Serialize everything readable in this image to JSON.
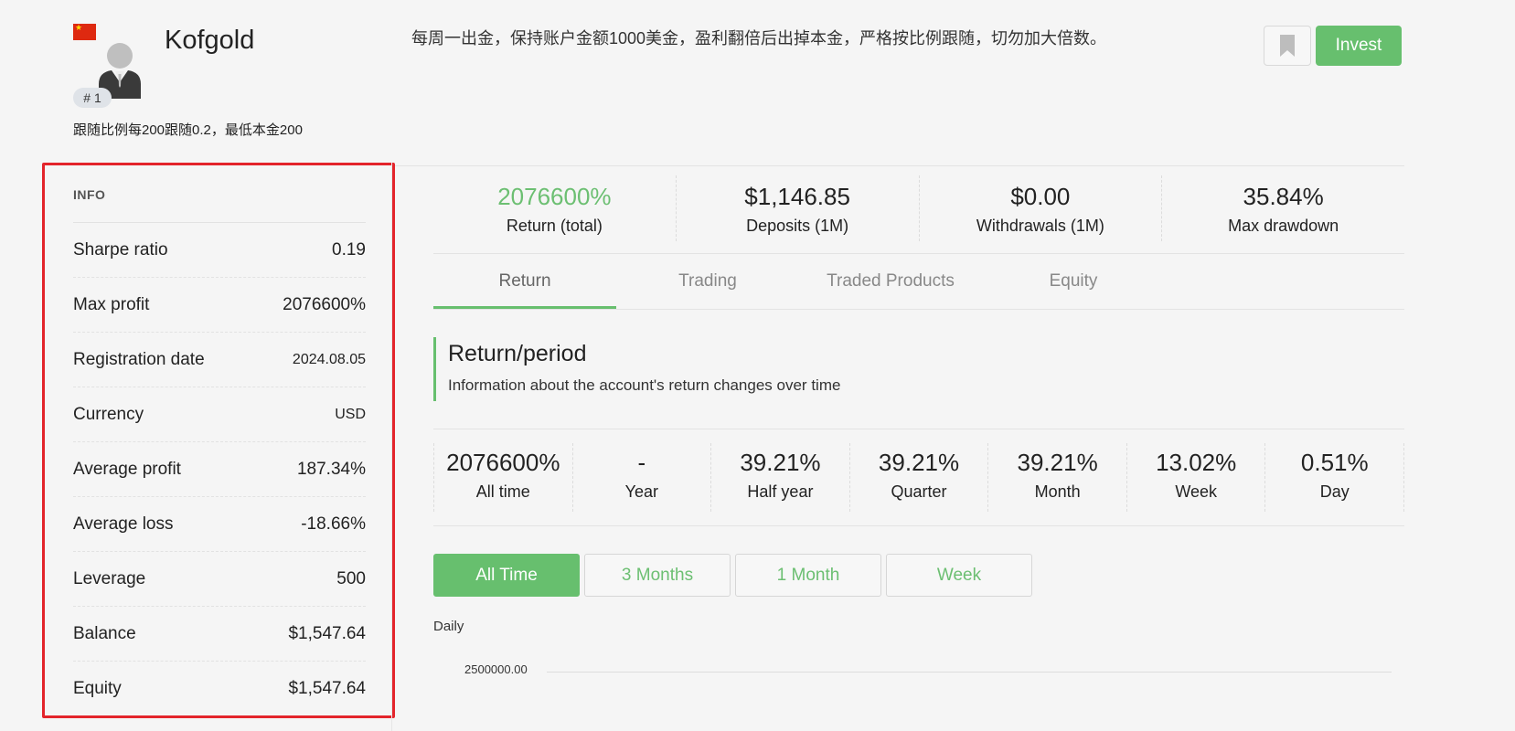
{
  "header": {
    "trader_name": "Kofgold",
    "rank": "# 1",
    "follow_note": "跟随比例每200跟随0.2，最低本金200",
    "description": "每周一出金，保持账户金额1000美金，盈利翻倍后出掉本金，严格按比例跟随，切勿加大倍数。",
    "invest_label": "Invest",
    "flag_icon": "china-flag-icon",
    "bookmark_icon": "bookmark-icon"
  },
  "info": {
    "title": "INFO",
    "rows": [
      {
        "label": "Sharpe ratio",
        "value": "0.19"
      },
      {
        "label": "Max profit",
        "value": "2076600%"
      },
      {
        "label": "Registration date",
        "value": "2024.08.05"
      },
      {
        "label": "Currency",
        "value": "USD"
      },
      {
        "label": "Average profit",
        "value": "187.34%"
      },
      {
        "label": "Average loss",
        "value": "-18.66%"
      },
      {
        "label": "Leverage",
        "value": "500"
      },
      {
        "label": "Balance",
        "value": "$1,547.64"
      },
      {
        "label": "Equity",
        "value": "$1,547.64"
      }
    ]
  },
  "stats": [
    {
      "value": "2076600%",
      "label": "Return (total)"
    },
    {
      "value": "$1,146.85",
      "label": "Deposits (1M)"
    },
    {
      "value": "$0.00",
      "label": "Withdrawals (1M)"
    },
    {
      "value": "35.84%",
      "label": "Max drawdown"
    }
  ],
  "tabs": [
    "Return",
    "Trading",
    "Traded Products",
    "Equity"
  ],
  "section": {
    "title": "Return/period",
    "subtitle": "Information about the account's return changes over time"
  },
  "periods": [
    {
      "value": "2076600%",
      "label": "All time"
    },
    {
      "value": "-",
      "label": "Year"
    },
    {
      "value": "39.21%",
      "label": "Half year"
    },
    {
      "value": "39.21%",
      "label": "Quarter"
    },
    {
      "value": "39.21%",
      "label": "Month"
    },
    {
      "value": "13.02%",
      "label": "Week"
    },
    {
      "value": "0.51%",
      "label": "Day"
    }
  ],
  "range_buttons": [
    "All Time",
    "3 Months",
    "1 Month",
    "Week"
  ],
  "chart": {
    "label": "Daily",
    "tick": "2500000.00"
  },
  "colors": {
    "accent": "#67bf6e",
    "highlight_border": "#e3242b"
  }
}
